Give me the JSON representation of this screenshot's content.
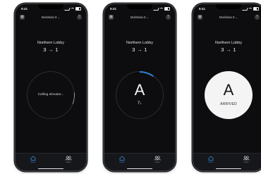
{
  "status_time": "9:41",
  "building_name": "Matinkatu 8",
  "building_chevron": "⌄",
  "lobby_name": "Northern Lobby",
  "floors": "3 → 1",
  "screen1": {
    "calling_text": "Calling elevator..."
  },
  "screen2": {
    "elevator_letter": "A",
    "current_floor": "7↓"
  },
  "screen3": {
    "elevator_letter": "A",
    "arrived_text": "ARRIVED"
  },
  "tabs": [
    {
      "label": "Home",
      "icon": "home-icon",
      "active": true
    },
    {
      "label": "Users",
      "icon": "users-icon",
      "active": false
    }
  ],
  "colors": {
    "background": "#0d0d0f",
    "accent": "#3b8ae0",
    "arrived_disc": "#f4f4f4"
  }
}
